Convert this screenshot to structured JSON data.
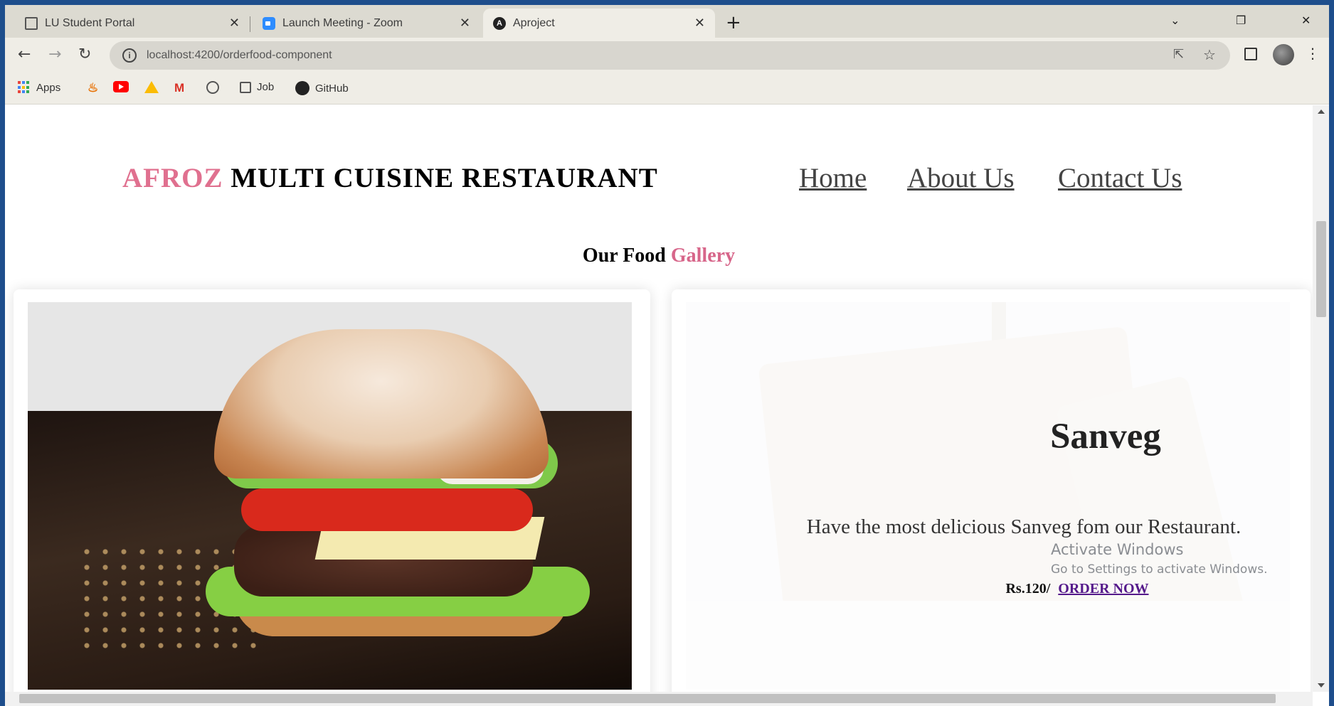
{
  "tabs": [
    {
      "label": "LU Student Portal",
      "icon": "portal-icon",
      "active": false
    },
    {
      "label": "Launch Meeting - Zoom",
      "icon": "zoom-icon",
      "active": false
    },
    {
      "label": "Aproject",
      "icon": "angular-icon",
      "active": true
    }
  ],
  "window_controls": {
    "minimize": "⌄",
    "restore": "❐",
    "close": "✕"
  },
  "address_bar": {
    "url": "localhost:4200/orderfood-component"
  },
  "bookmarks": [
    {
      "label": "Apps",
      "icon": "apps-grid-icon"
    },
    {
      "label": "",
      "icon": "java-icon"
    },
    {
      "label": "",
      "icon": "youtube-icon"
    },
    {
      "label": "",
      "icon": "google-drive-icon"
    },
    {
      "label": "",
      "icon": "gmail-icon"
    },
    {
      "label": "",
      "icon": "globe-icon"
    },
    {
      "label": "Job",
      "icon": "job-icon"
    },
    {
      "label": "GitHub",
      "icon": "github-icon"
    }
  ],
  "header": {
    "brand_accent": "AFROZ",
    "brand_rest": "MULTI CUISINE RESTAURANT",
    "nav": [
      "Home",
      "About Us",
      "Contact Us"
    ]
  },
  "gallery": {
    "title_part1": "Our Food",
    "title_part2": "Gallery"
  },
  "cards": [
    {
      "image": "burger-image"
    },
    {
      "image": "sandwich-image",
      "title": "Sanveg",
      "description": "Have the most delicious Sanveg fom our Restaurant.",
      "price": "Rs.120/",
      "order_label": "ORDER NOW"
    }
  ],
  "watermark": {
    "line1": "Activate Windows",
    "line2": "Go to Settings to activate Windows."
  },
  "colors": {
    "accent_pink": "#e0708f",
    "link_purple": "#551a8b",
    "desktop_blue": "#1e4e8c"
  }
}
